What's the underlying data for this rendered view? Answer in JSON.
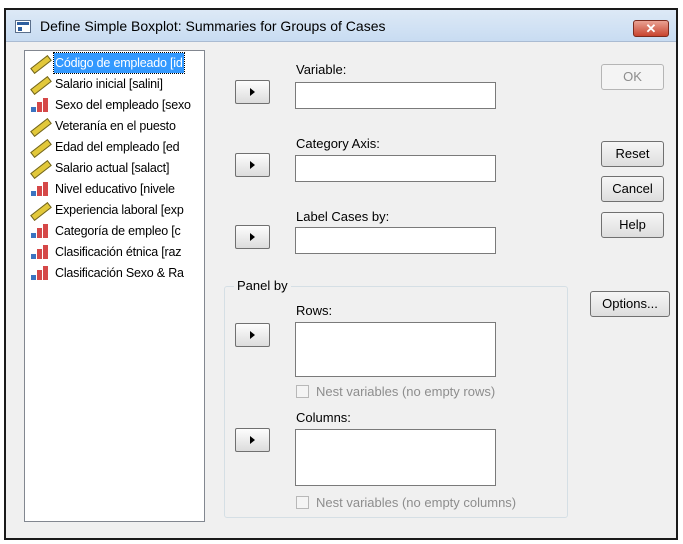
{
  "window": {
    "title": "Define Simple Boxplot: Summaries for Groups of Cases",
    "close_glyph": "✕"
  },
  "variables": [
    {
      "label": "Código de empleado [id",
      "icon": "scale-ruler-icon",
      "selected": true
    },
    {
      "label": "Salario inicial [salini]",
      "icon": "scale-ruler-icon"
    },
    {
      "label": "Sexo del empleado [sexo",
      "icon": "nominal-bars-icon"
    },
    {
      "label": "Veteranía en el puesto",
      "icon": "scale-ruler-icon"
    },
    {
      "label": "Edad del empleado [ed",
      "icon": "scale-ruler-icon"
    },
    {
      "label": "Salario actual [salact]",
      "icon": "scale-ruler-icon"
    },
    {
      "label": "Nivel educativo [nivele",
      "icon": "nominal-bars-icon"
    },
    {
      "label": "Experiencia laboral [exp",
      "icon": "scale-ruler-icon"
    },
    {
      "label": "Categoría de empleo [c",
      "icon": "nominal-bars-icon"
    },
    {
      "label": "Clasificación étnica [raz",
      "icon": "nominal-bars-icon"
    },
    {
      "label": "Clasificación Sexo & Ra",
      "icon": "nominal-bars-icon"
    }
  ],
  "fields": {
    "variable": {
      "label": "Variable:",
      "value": ""
    },
    "category_axis": {
      "label": "Category Axis:",
      "value": ""
    },
    "label_cases": {
      "label": "Label Cases by:",
      "value": ""
    }
  },
  "panel": {
    "legend": "Panel by",
    "rows_label": "Rows:",
    "nest_rows": "Nest variables (no empty rows)",
    "columns_label": "Columns:",
    "nest_columns": "Nest variables (no empty columns)"
  },
  "buttons": {
    "ok": "OK",
    "reset": "Reset",
    "cancel": "Cancel",
    "help": "Help",
    "options": "Options..."
  }
}
